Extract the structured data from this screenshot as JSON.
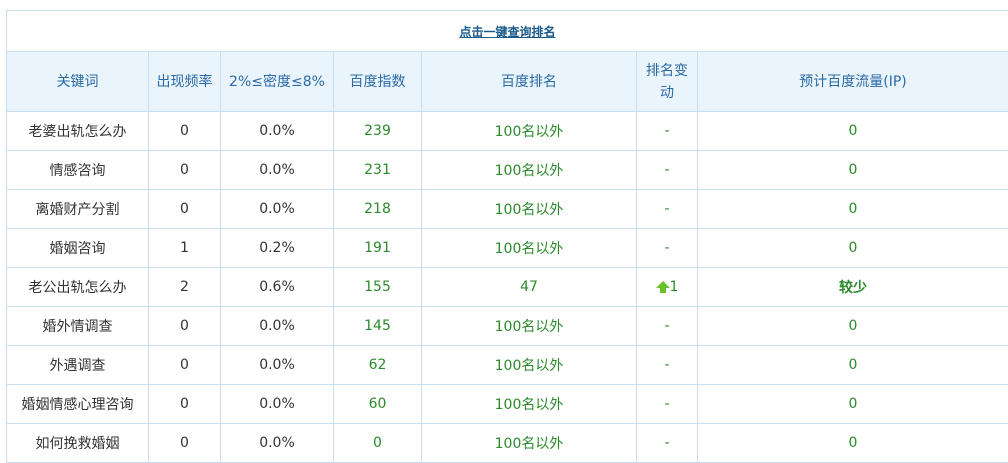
{
  "top_link": "点击一键查询排名",
  "columns": [
    "关键词",
    "出现频率",
    "2%≤密度≤8%",
    "百度指数",
    "百度排名",
    "排名变动",
    "预计百度流量(IP)"
  ],
  "rows": [
    {
      "keyword": "老婆出轨怎么办",
      "freq": "0",
      "density": "0.0%",
      "index": "239",
      "rank": "100名以外",
      "change": "-",
      "traffic": "0"
    },
    {
      "keyword": "情感咨询",
      "freq": "0",
      "density": "0.0%",
      "index": "231",
      "rank": "100名以外",
      "change": "-",
      "traffic": "0"
    },
    {
      "keyword": "离婚财产分割",
      "freq": "0",
      "density": "0.0%",
      "index": "218",
      "rank": "100名以外",
      "change": "-",
      "traffic": "0"
    },
    {
      "keyword": "婚姻咨询",
      "freq": "1",
      "density": "0.2%",
      "index": "191",
      "rank": "100名以外",
      "change": "-",
      "traffic": "0"
    },
    {
      "keyword": "老公出轨怎么办",
      "freq": "2",
      "density": "0.6%",
      "index": "155",
      "rank": "47",
      "change": "1",
      "change_icon": "up-arrow-icon",
      "traffic": "较少"
    },
    {
      "keyword": "婚外情调查",
      "freq": "0",
      "density": "0.0%",
      "index": "145",
      "rank": "100名以外",
      "change": "-",
      "traffic": "0"
    },
    {
      "keyword": "外遇调查",
      "freq": "0",
      "density": "0.0%",
      "index": "62",
      "rank": "100名以外",
      "change": "-",
      "traffic": "0"
    },
    {
      "keyword": "婚姻情感心理咨询",
      "freq": "0",
      "density": "0.0%",
      "index": "60",
      "rank": "100名以外",
      "change": "-",
      "traffic": "0"
    },
    {
      "keyword": "如何挽救婚姻",
      "freq": "0",
      "density": "0.0%",
      "index": "0",
      "rank": "100名以外",
      "change": "-",
      "traffic": "0"
    }
  ],
  "colors": {
    "header_bg": "#eaf4fc",
    "header_text": "#2a6aa6",
    "border": "#c9dfef",
    "value_green": "#2b8a2b",
    "arrow_green": "#6bbf2a"
  }
}
